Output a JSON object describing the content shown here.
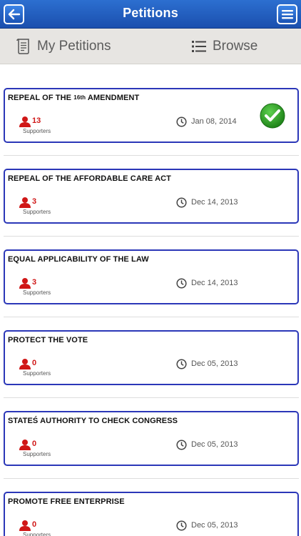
{
  "header": {
    "title": "Petitions",
    "back_icon": "back-arrow-icon",
    "menu_icon": "menu-icon",
    "bar_color": "#1f5bbd"
  },
  "tabs": [
    {
      "label": "My Petitions",
      "icon": "document-icon"
    },
    {
      "label": "Browse",
      "icon": "list-icon"
    }
  ],
  "supporters_label": "Supporters",
  "colors": {
    "card_border": "#2b37b8",
    "count": "#d01717",
    "check": "#2e9e2a"
  },
  "petitions": [
    {
      "title": "REPEAL OF THE ",
      "title_ord": "16th",
      "title_end": " AMENDMENT",
      "count": "13",
      "date": "Jan 08, 2014",
      "signed": true
    },
    {
      "title": "REPEAL OF THE AFFORDABLE CARE ACT",
      "count": "3",
      "date": "Dec 14, 2013",
      "signed": false
    },
    {
      "title": "EQUAL APPLICABILITY OF THE LAW",
      "count": "3",
      "date": "Dec 14, 2013",
      "signed": false
    },
    {
      "title": "PROTECT THE VOTE",
      "count": "0",
      "date": "Dec 05, 2013",
      "signed": false
    },
    {
      "title": "STATEŚ AUTHORITY TO CHECK CONGRESS",
      "count": "0",
      "date": "Dec 05, 2013",
      "signed": false
    },
    {
      "title": "PROMOTE FREE ENTERPRISE",
      "count": "0",
      "date": "Dec 05, 2013",
      "signed": false
    }
  ]
}
